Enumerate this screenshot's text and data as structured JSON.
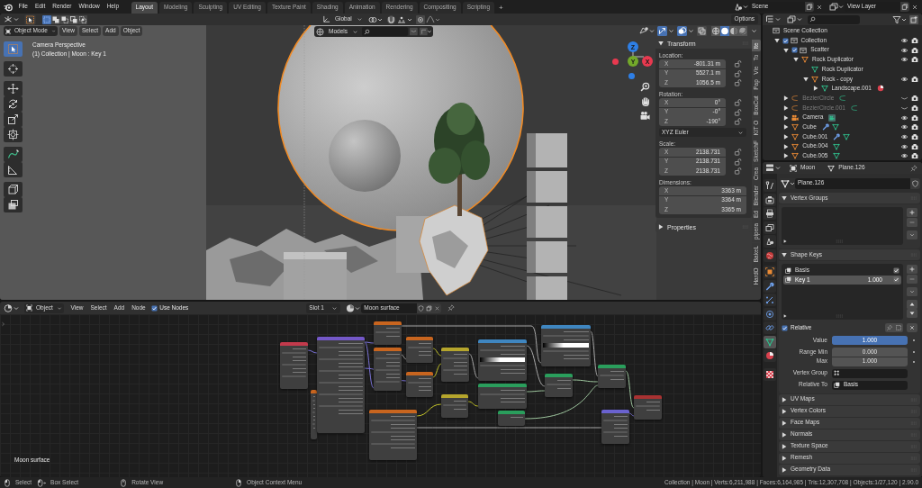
{
  "top_bar": {
    "menus": [
      "File",
      "Edit",
      "Render",
      "Window",
      "Help"
    ],
    "workspaces": [
      {
        "label": "Layout",
        "selected": true
      },
      {
        "label": "Modeling",
        "selected": false
      },
      {
        "label": "Sculpting",
        "selected": false
      },
      {
        "label": "UV Editing",
        "selected": false
      },
      {
        "label": "Texture Paint",
        "selected": false
      },
      {
        "label": "Shading",
        "selected": false
      },
      {
        "label": "Animation",
        "selected": false
      },
      {
        "label": "Rendering",
        "selected": false
      },
      {
        "label": "Compositing",
        "selected": false
      },
      {
        "label": "Scripting",
        "selected": false
      }
    ],
    "add_workspace": "+",
    "scene": "Scene",
    "view_layer": "View Layer"
  },
  "viewport": {
    "tool_settings": {
      "select_modes": [
        {
          "selected": true
        },
        {
          "selected": false
        },
        {
          "selected": false
        },
        {
          "selected": false
        },
        {
          "selected": false
        }
      ],
      "orientation": "Global",
      "options": "Options"
    },
    "header": {
      "mode": "Object Mode",
      "menus": [
        "View",
        "Select",
        "Add",
        "Object"
      ],
      "asset_library": "Models",
      "toggles": [
        {
          "kind": "gizmo",
          "on": true
        },
        {
          "kind": "overlays",
          "on": true
        },
        {
          "kind": "xray",
          "on": false
        }
      ],
      "shading": [
        {
          "kind": "wireframe",
          "selected": false
        },
        {
          "kind": "solid",
          "selected": true
        },
        {
          "kind": "material",
          "selected": false
        },
        {
          "kind": "rendered",
          "selected": false
        }
      ]
    },
    "overlay_text": [
      "Camera Perspective",
      "(1) Collection | Moon : Key 1"
    ],
    "tools": [
      {
        "kind": "select",
        "selected": true
      },
      {
        "kind": "cursor",
        "selected": false
      },
      {
        "kind": "move",
        "selected": false
      },
      {
        "kind": "rotate",
        "selected": false
      },
      {
        "kind": "scale",
        "selected": false
      },
      {
        "kind": "transform",
        "selected": false
      },
      {
        "kind": "annotate",
        "selected": false
      },
      {
        "kind": "measure",
        "selected": false
      },
      {
        "kind": "add_cube",
        "selected": false
      },
      {
        "kind": "extrude",
        "selected": false
      }
    ],
    "gizmo": [
      {
        "label": "Z",
        "color": "#2e7fe6"
      },
      {
        "label": "Y",
        "color": "#73a92a"
      },
      {
        "label": "X",
        "color": "#e8394f"
      }
    ],
    "sidebar": {
      "tabs": [
        {
          "label": "Ite",
          "selected": true
        },
        {
          "label": "To",
          "selected": false
        },
        {
          "label": "Vie",
          "selected": false
        },
        {
          "label": "Pap",
          "selected": false
        },
        {
          "label": "BoxCut",
          "selected": false
        },
        {
          "label": "KIT O",
          "selected": false
        },
        {
          "label": "SketchF",
          "selected": false
        },
        {
          "label": "Crea",
          "selected": false
        },
        {
          "label": "Blender",
          "selected": false
        },
        {
          "label": "Ed",
          "selected": false
        },
        {
          "label": "pipera",
          "selected": false
        },
        {
          "label": "BakeL",
          "selected": false
        },
        {
          "label": "HardO",
          "selected": false
        }
      ],
      "panels": [
        {
          "title": "Transform",
          "expanded": true,
          "groups": [
            {
              "label": "Location:",
              "lockable": true,
              "fields": [
                {
                  "axis": "X",
                  "value": "-801.31 m"
                },
                {
                  "axis": "Y",
                  "value": "5527.1 m"
                },
                {
                  "axis": "Z",
                  "value": "1056.5 m"
                }
              ]
            },
            {
              "label": "Rotation:",
              "lockable": true,
              "fields": [
                {
                  "axis": "X",
                  "value": "0°"
                },
                {
                  "axis": "Y",
                  "value": "-0°"
                },
                {
                  "axis": "Z",
                  "value": "-190°"
                }
              ],
              "mode": "XYZ Euler"
            },
            {
              "label": "Scale:",
              "lockable": true,
              "fields": [
                {
                  "axis": "X",
                  "value": "2138.731"
                },
                {
                  "axis": "Y",
                  "value": "2138.731"
                },
                {
                  "axis": "Z",
                  "value": "2138.731"
                }
              ]
            },
            {
              "label": "Dimensions:",
              "lockable": false,
              "fields": [
                {
                  "axis": "X",
                  "value": "3363 m"
                },
                {
                  "axis": "Y",
                  "value": "3364 m"
                },
                {
                  "axis": "Z",
                  "value": "3365 m"
                }
              ]
            }
          ]
        },
        {
          "title": "Properties",
          "expanded": false
        }
      ]
    }
  },
  "node_editor": {
    "header": {
      "shader_type": "Object",
      "menus": [
        "View",
        "Select",
        "Add",
        "Node"
      ],
      "use_nodes": {
        "label": "Use Nodes",
        "checked": true
      },
      "slot": "Slot 1",
      "material": "Moon surface"
    },
    "material_label": "Moon surface",
    "nodes": [
      {
        "color": "#c23a4c"
      },
      {
        "color": "#c8651f"
      },
      {
        "color": "#7458c8"
      },
      {
        "color": "#c8651f"
      },
      {
        "color": "#c8651f"
      },
      {
        "color": "#c8651f"
      },
      {
        "color": "#c8651f"
      },
      {
        "color": "#c8651f"
      },
      {
        "color": "#b5a52c"
      },
      {
        "color": "#b5a52c"
      },
      {
        "color": "#3f86c0"
      },
      {
        "color": "#3f86c0"
      },
      {
        "color": "#2a9e5c"
      },
      {
        "color": "#2a9e5c"
      },
      {
        "color": "#2a9e5c"
      },
      {
        "color": "#2a9e5c"
      },
      {
        "color": "#6a62cf"
      },
      {
        "color": "#a83232"
      }
    ],
    "links": [
      {
        "kind": "vector"
      },
      {
        "kind": "vector"
      },
      {
        "kind": "vector"
      },
      {
        "kind": "vector"
      },
      {
        "kind": "float"
      },
      {
        "kind": "float"
      },
      {
        "kind": "color"
      },
      {
        "kind": "color"
      },
      {
        "kind": "color"
      },
      {
        "kind": "float"
      },
      {
        "kind": "float"
      },
      {
        "kind": "float"
      },
      {
        "kind": "float"
      },
      {
        "kind": "shader"
      },
      {
        "kind": "vector"
      },
      {
        "kind": "shader"
      },
      {
        "kind": "shader"
      },
      {
        "kind": "shader"
      },
      {
        "kind": "color"
      }
    ]
  },
  "outliner": {
    "root": "Scene Collection",
    "items": [
      {
        "label": "Collection",
        "kind": "collection",
        "checked": true,
        "expanded": true,
        "hidden": false,
        "children": [
          {
            "label": "Scatter",
            "kind": "collection",
            "checked": true,
            "expanded": true,
            "hidden": false,
            "children": [
              {
                "label": "Rock Duplicator",
                "kind": "mesh_object",
                "expanded": true,
                "hidden": false,
                "children": [
                  {
                    "label": "Rock Duplicator",
                    "kind": "mesh_data"
                  },
                  {
                    "label": "Rock - copy",
                    "kind": "mesh_object",
                    "expanded": true,
                    "hidden": false,
                    "children": [
                      {
                        "label": "Landscape.001",
                        "kind": "mesh_data",
                        "expanded": false,
                        "extras": [
                          {
                            "kind": "material"
                          }
                        ]
                      }
                    ]
                  }
                ]
              }
            ]
          },
          {
            "label": "BezierCircle",
            "kind": "curve_object",
            "expanded": false,
            "hidden": true,
            "extras": [
              {
                "kind": "curve_data"
              }
            ]
          },
          {
            "label": "BezierCircle.001",
            "kind": "curve_object",
            "expanded": false,
            "hidden": true,
            "extras": [
              {
                "kind": "curve_data"
              }
            ]
          },
          {
            "label": "Camera",
            "kind": "camera_object",
            "expanded": false,
            "hidden": false,
            "extras": [
              {
                "kind": "camera_data"
              }
            ]
          },
          {
            "label": "Cube",
            "kind": "mesh_object",
            "expanded": false,
            "hidden": false,
            "extras": [
              {
                "kind": "modifier"
              },
              {
                "kind": "mesh_data"
              }
            ]
          },
          {
            "label": "Cube.001",
            "kind": "mesh_object",
            "expanded": false,
            "hidden": false,
            "extras": [
              {
                "kind": "modifier"
              },
              {
                "kind": "mesh_data"
              }
            ]
          },
          {
            "label": "Cube.004",
            "kind": "mesh_object",
            "expanded": false,
            "hidden": false,
            "extras": [
              {
                "kind": "mesh_data"
              }
            ]
          },
          {
            "label": "Cube.005",
            "kind": "mesh_object",
            "expanded": false,
            "hidden": false,
            "extras": [
              {
                "kind": "mesh_data"
              }
            ]
          }
        ]
      }
    ]
  },
  "properties": {
    "header": {
      "object": "Moon",
      "data": "Plane.126"
    },
    "tabs": [
      {
        "kind": "tool",
        "selected": false
      },
      {
        "kind": "render",
        "selected": false
      },
      {
        "kind": "output",
        "selected": false
      },
      {
        "kind": "view_layer",
        "selected": false
      },
      {
        "kind": "scene",
        "selected": false
      },
      {
        "kind": "world",
        "selected": false
      },
      {
        "kind": "object",
        "selected": false
      },
      {
        "kind": "modifiers",
        "selected": false
      },
      {
        "kind": "particles",
        "selected": false
      },
      {
        "kind": "physics",
        "selected": false
      },
      {
        "kind": "constraints",
        "selected": false
      },
      {
        "kind": "data",
        "selected": true
      },
      {
        "kind": "material",
        "selected": false
      },
      {
        "kind": "texture",
        "selected": false
      }
    ],
    "datablock": "Plane.126",
    "panels": [
      {
        "title": "Vertex Groups",
        "expanded": true,
        "kind": "vertex_groups"
      },
      {
        "title": "Shape Keys",
        "expanded": true,
        "kind": "shape_keys",
        "keys": [
          {
            "name": "Basis",
            "checked": true,
            "selected": false
          },
          {
            "name": "Key 1",
            "value": "1.000",
            "checked": true,
            "selected": true
          }
        ],
        "relative": {
          "label": "Relative",
          "checked": true
        },
        "fields": [
          {
            "kind": "slider",
            "label": "Value",
            "value": "1.000",
            "level": 1
          },
          {
            "kind": "number",
            "label": "Range Min",
            "value": "0.000"
          },
          {
            "kind": "number",
            "label": "Max",
            "value": "1.000"
          },
          {
            "kind": "search",
            "label": "Vertex Group"
          },
          {
            "kind": "search",
            "label": "Relative To",
            "value": "Basis"
          }
        ]
      },
      {
        "title": "UV Maps",
        "expanded": false
      },
      {
        "title": "Vertex Colors",
        "expanded": false
      },
      {
        "title": "Face Maps",
        "expanded": false
      },
      {
        "title": "Normals",
        "expanded": false
      },
      {
        "title": "Texture Space",
        "expanded": false
      },
      {
        "title": "Remesh",
        "expanded": false
      },
      {
        "title": "Geometry Data",
        "expanded": false
      }
    ]
  },
  "status_bar": {
    "hints": [
      {
        "kind": "mouse_left",
        "label": "Select"
      },
      {
        "kind": "mouse_drag",
        "label": "Box Select"
      },
      {
        "kind": "mouse_middle",
        "label": "Rotate View"
      },
      {
        "kind": "mouse_right",
        "label": "Object Context Menu"
      }
    ],
    "stats": "Collection | Moon | Verts:6,211,988 | Faces:6,164,985 | Tris:12,307,708 | Objects:1/27,120 | 2.90.0"
  }
}
